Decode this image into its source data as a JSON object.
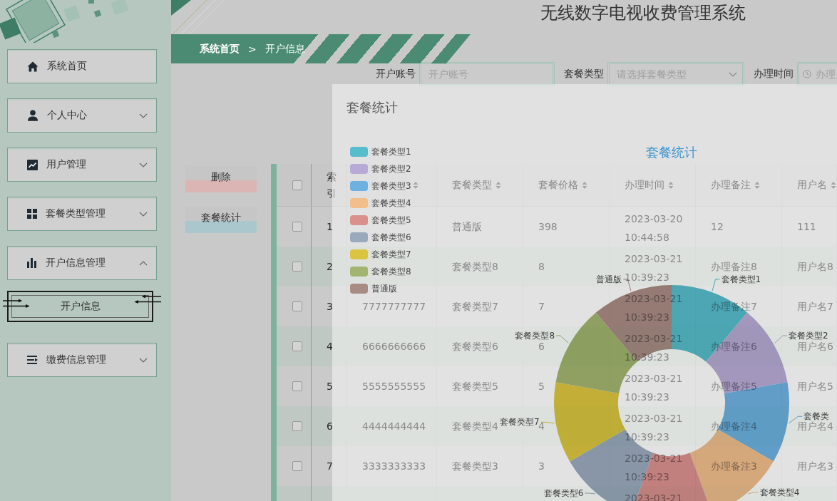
{
  "sidebar": {
    "items": [
      {
        "kind": "link",
        "label": "系统首页"
      },
      {
        "kind": "group",
        "label": "个人中心",
        "expanded": false
      },
      {
        "kind": "group",
        "label": "用户管理",
        "expanded": false
      },
      {
        "kind": "group",
        "label": "套餐类型管理",
        "expanded": false
      },
      {
        "kind": "group",
        "label": "开户信息管理",
        "expanded": true,
        "children": [
          {
            "label": "开户信息",
            "selected": true
          }
        ]
      },
      {
        "kind": "group",
        "label": "缴费信息管理",
        "expanded": false
      }
    ]
  },
  "header": {
    "title": "无线数字电视收费管理系统"
  },
  "breadcrumb": {
    "separator": ">",
    "items": [
      {
        "label": "系统首页",
        "current": false
      },
      {
        "label": "开户信息",
        "current": true
      }
    ]
  },
  "search": {
    "fields": [
      {
        "kind": "text",
        "label": "开户账号",
        "placeholder": "开户账号"
      },
      {
        "kind": "select",
        "label": "套餐类型",
        "placeholder": "请选择套餐类型"
      },
      {
        "kind": "date",
        "label": "办理时间",
        "placeholder": "办理"
      }
    ]
  },
  "actions": [
    {
      "kind": "danger",
      "label": "删除"
    },
    {
      "kind": "info",
      "label": "套餐统计"
    }
  ],
  "table": {
    "select_all": {
      "checked": false
    },
    "columns": [
      {
        "kind": "index",
        "label": "索引",
        "sortable": false
      },
      {
        "kind": "text",
        "sortable": true
      },
      {
        "kind": "text",
        "label": "套餐类型",
        "sortable": true
      },
      {
        "kind": "text",
        "label": "套餐价格",
        "sortable": true
      },
      {
        "kind": "datetime",
        "label": "办理时间",
        "sortable": true
      },
      {
        "kind": "text",
        "label": "办理备注",
        "sortable": true
      },
      {
        "kind": "text",
        "label": "用户名",
        "sortable": true
      }
    ],
    "rows": [
      {
        "checked": false,
        "cells": [
          "1",
          null,
          "普通版",
          "398",
          "2023-03-20 10:44:58",
          "12",
          "111"
        ]
      },
      {
        "checked": false,
        "cells": [
          "2",
          null,
          "套餐类型8",
          "8",
          "2023-03-21 10:39:23",
          "办理备注8",
          "用户名8"
        ]
      },
      {
        "checked": false,
        "cells": [
          "3",
          "7777777777",
          "套餐类型7",
          "7",
          "2023-03-21 10:39:23",
          "办理备注7",
          "用户名7"
        ]
      },
      {
        "checked": false,
        "cells": [
          "4",
          "6666666666",
          "套餐类型6",
          "6",
          "2023-03-21 10:39:23",
          "办理备注6",
          "用户名6"
        ]
      },
      {
        "checked": false,
        "cells": [
          "5",
          "5555555555",
          "套餐类型5",
          "5",
          "2023-03-21 10:39:23",
          "办理备注5",
          "用户名5"
        ]
      },
      {
        "checked": false,
        "cells": [
          "6",
          "4444444444",
          "套餐类型4",
          "4",
          "2023-03-21 10:39:23",
          "办理备注4",
          "用户名4"
        ]
      },
      {
        "checked": false,
        "cells": [
          "7",
          "3333333333",
          "套餐类型3",
          "3",
          "2023-03-21 10:39:23",
          "办理备注3",
          "用户名3"
        ]
      },
      {
        "cells": [
          null,
          null,
          null,
          null,
          "2023-03-21",
          null,
          null
        ]
      }
    ]
  },
  "dialog": {
    "title": "套餐统计",
    "chart": {
      "title": "套餐统计",
      "series": [
        {
          "name": "套餐类型1",
          "color": "#57bccb",
          "label": "套餐类型1"
        },
        {
          "name": "套餐类型2",
          "color": "#b8aad6",
          "label": "套餐类型2"
        },
        {
          "name": "套餐类型3",
          "color": "#6eb1e1",
          "label": "套餐类"
        },
        {
          "name": "套餐类型4",
          "color": "#f1be8c",
          "label": "套餐类型4"
        },
        {
          "name": "套餐类型5",
          "color": "#da908d"
        },
        {
          "name": "套餐类型6",
          "color": "#9ba9bd",
          "label": "套餐类型6"
        },
        {
          "name": "套餐类型7",
          "color": "#dcc43f",
          "label": "套餐类型7"
        },
        {
          "name": "套餐类型8",
          "color": "#a2b46f",
          "label": "套餐类型8"
        },
        {
          "name": "普通版",
          "color": "#a88b83",
          "label": "普通版"
        }
      ]
    }
  }
}
